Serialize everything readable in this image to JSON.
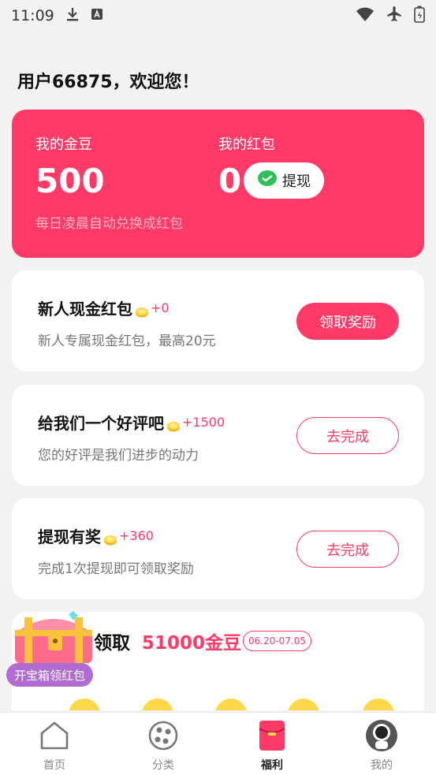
{
  "status_bar": {
    "time": "11:09"
  },
  "greeting": "用户66875，欢迎您！",
  "wallet": {
    "beans_label": "我的金豆",
    "beans_value": "500",
    "redpacket_label": "我的红包",
    "redpacket_value": "0",
    "withdraw_label": "提现",
    "hint": "每日凌晨自动兑换成红包"
  },
  "tasks": [
    {
      "title": "新人现金红包",
      "reward": "+0",
      "desc": "新人专属现金红包，最高20元",
      "button": "领取奖励"
    },
    {
      "title": "给我们一个好评吧",
      "reward": "+1500",
      "desc": "您的好评是我们进步的动力",
      "button": "去完成"
    },
    {
      "title": "提现有奖",
      "reward": "+360",
      "desc": "完成1次提现即可领取奖励",
      "button": "去完成"
    }
  ],
  "chest_card": {
    "title": "领取",
    "amount": "51000金豆",
    "date_range": "06.20-07.05",
    "badge": "开宝箱领红包"
  },
  "tabbar": [
    {
      "label": "首页",
      "icon": "home-icon"
    },
    {
      "label": "分类",
      "icon": "category-icon"
    },
    {
      "label": "福利",
      "icon": "red-envelope-icon"
    },
    {
      "label": "我的",
      "icon": "profile-avatar-icon"
    }
  ],
  "colors": {
    "accent": "#ff3a66",
    "badge": "#b16cd3",
    "background": "#f2f2f2"
  }
}
